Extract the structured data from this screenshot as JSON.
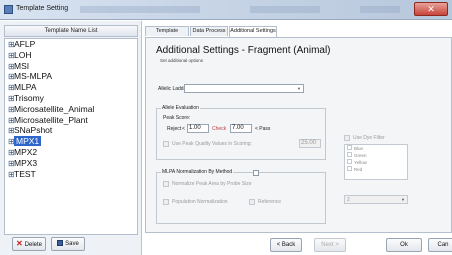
{
  "window": {
    "title": "Template Setting",
    "close_glyph": "✕"
  },
  "left_panel": {
    "header": "Template Name List",
    "templates": [
      {
        "label": "AFLP"
      },
      {
        "label": "LOH"
      },
      {
        "label": "MSI"
      },
      {
        "label": "MS-MLPA"
      },
      {
        "label": "MLPA"
      },
      {
        "label": "Trisomy"
      },
      {
        "label": "Microsatellite_Animal"
      },
      {
        "label": "Microsatellite_Plant"
      },
      {
        "label": "SNaPshot"
      },
      {
        "label": "MPX1",
        "selected": true
      },
      {
        "label": "MPX2"
      },
      {
        "label": "MPX3"
      },
      {
        "label": "TEST"
      }
    ],
    "delete_label": "Delete",
    "save_label": "Save"
  },
  "tabs": [
    {
      "label": "Template Section"
    },
    {
      "label": "Data Process"
    },
    {
      "label": "Additional Settings",
      "active": true
    }
  ],
  "main": {
    "title": "Additional Settings - Fragment (Animal)",
    "subtitle": "Set additional options",
    "allelic_ladder_label": "Allelic Ladder :",
    "allelic_ladder_value": "",
    "allele_evaluation": {
      "group_title": "Allele Evaluation",
      "peak_score_label": "Peak Score:",
      "reject_label": "Reject",
      "reject_lt": "<",
      "reject_value": "1.00",
      "check_label": "Check",
      "pass_value": "7.00",
      "pass_label": "< Pass",
      "use_option_label": "Use Peak Quality Values in Scoring:",
      "use_option_value": "25.00"
    },
    "mlpa": {
      "group_title": "MLPA Normalization By Method",
      "method_value": "",
      "sub_option_1": "Normalize Peak Area by Probe Size",
      "sub_option_2": "Population Normalization",
      "sub_option_3": "Reference"
    },
    "right_options": {
      "check_label": "Use Dye Filter",
      "dyes": [
        "Blue",
        "Green",
        "Yellow",
        "Red"
      ],
      "dropdown_value": "2"
    }
  },
  "footer": {
    "back_label": "< Back",
    "next_label": "Next >",
    "ok_label": "Ok",
    "cancel_label": "Can"
  }
}
